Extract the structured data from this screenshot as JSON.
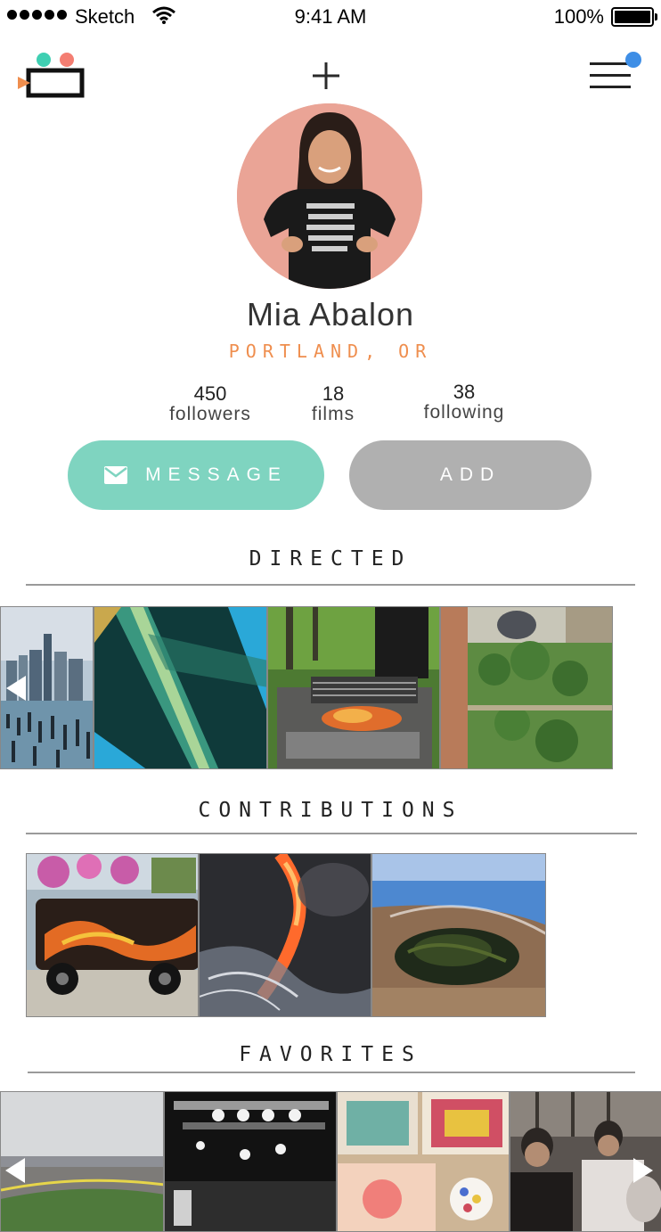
{
  "status_bar": {
    "carrier": "Sketch",
    "time": "9:41 AM",
    "battery": "100%"
  },
  "icons": {
    "logo": "camera-logo-icon",
    "add": "plus-icon",
    "menu": "hamburger-menu-icon",
    "notification": "notification-dot-icon",
    "message": "envelope-icon",
    "prev": "chevron-left-icon",
    "next": "chevron-right-icon"
  },
  "profile": {
    "name": "Mia Abalon",
    "location": "PORTLAND, OR",
    "stats": [
      {
        "value": "450",
        "label": "followers"
      },
      {
        "value": "18",
        "label": "films"
      },
      {
        "value": "38",
        "label": "following"
      }
    ]
  },
  "actions": {
    "message_label": "MESSAGE",
    "add_label": "ADD"
  },
  "sections": {
    "directed": {
      "title": "DIRECTED",
      "films": [
        "city-skyline-pier",
        "teal-light-rays",
        "campfire-grill",
        "courtyard-garden"
      ]
    },
    "contributions": {
      "title": "CONTRIBUTIONS",
      "films": [
        "flame-painted-truck",
        "lava-ocean",
        "seaweed-beach"
      ]
    },
    "favorites": {
      "title": "FAVORITES",
      "films": [
        "racetrack",
        "concert-stage",
        "paint-palette",
        "friends-group"
      ]
    }
  },
  "colors": {
    "accent_teal": "#7fd4c0",
    "accent_orange": "#ef8e4e",
    "notification_blue": "#3e8ee6",
    "button_gray": "#b0b0b0"
  }
}
